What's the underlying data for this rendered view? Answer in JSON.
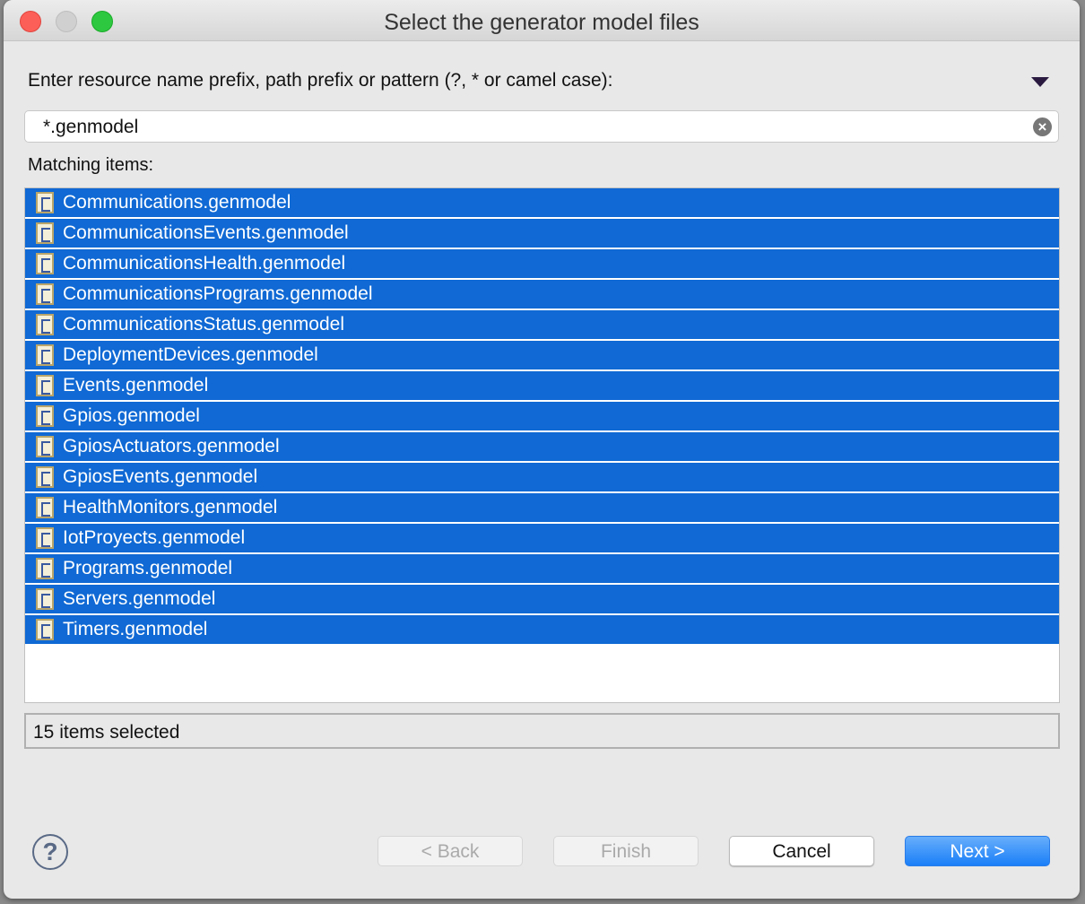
{
  "window": {
    "title": "Select the generator model files"
  },
  "prompt": "Enter resource name prefix, path prefix or pattern (?, * or camel case):",
  "search": {
    "value": "*.genmodel"
  },
  "matching_label": "Matching items:",
  "items": [
    "Communications.genmodel",
    "CommunicationsEvents.genmodel",
    "CommunicationsHealth.genmodel",
    "CommunicationsPrograms.genmodel",
    "CommunicationsStatus.genmodel",
    "DeploymentDevices.genmodel",
    "Events.genmodel",
    "Gpios.genmodel",
    "GpiosActuators.genmodel",
    "GpiosEvents.genmodel",
    "HealthMonitors.genmodel",
    "IotProyects.genmodel",
    "Programs.genmodel",
    "Servers.genmodel",
    "Timers.genmodel"
  ],
  "status": "15 items selected",
  "buttons": {
    "help": "?",
    "back": "< Back",
    "finish": "Finish",
    "cancel": "Cancel",
    "next": "Next >"
  },
  "colors": {
    "selection": "#1069d4",
    "primary": "#1a7ff8"
  }
}
